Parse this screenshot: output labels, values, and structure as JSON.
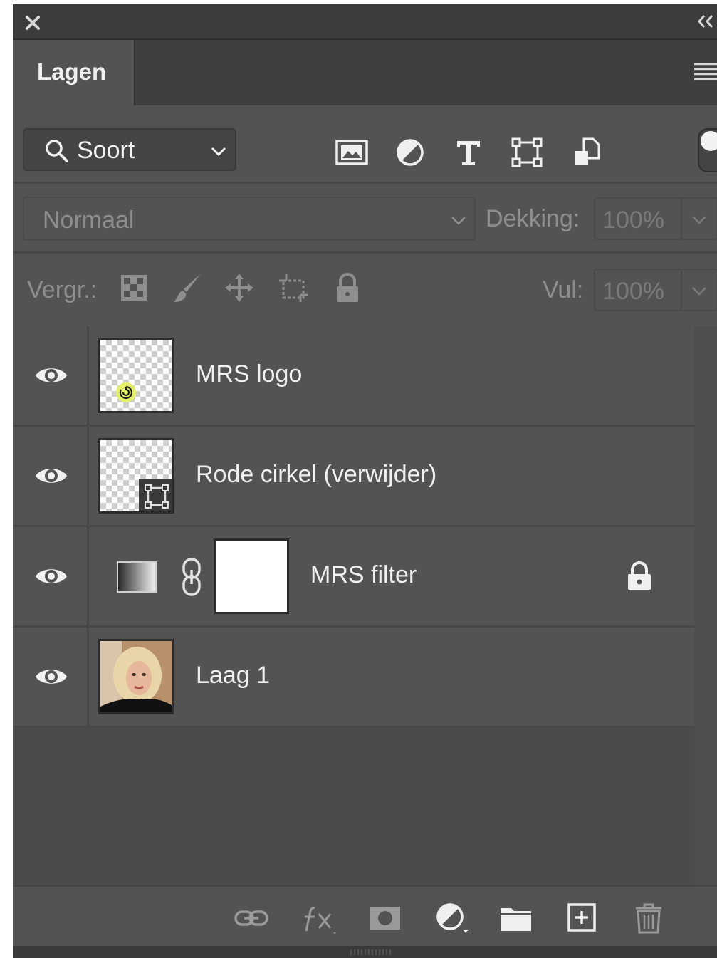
{
  "panel": {
    "tab_label": "Lagen"
  },
  "filter": {
    "kind_label": "Soort",
    "icons": [
      "pixel-layer-filter-icon",
      "adjustment-layer-filter-icon",
      "type-layer-filter-icon",
      "shape-layer-filter-icon",
      "smart-object-filter-icon"
    ]
  },
  "blend": {
    "mode": "Normaal",
    "opacity_label": "Dekking:",
    "opacity_value": "100%"
  },
  "lock": {
    "label": "Vergr.:",
    "fill_label": "Vul:",
    "fill_value": "100%"
  },
  "layers": [
    {
      "name": "MRS logo",
      "visible": true
    },
    {
      "name": "Rode cirkel (verwijder)",
      "visible": true
    },
    {
      "name": "MRS filter",
      "visible": true,
      "locked": true
    },
    {
      "name": "Laag 1",
      "visible": true
    }
  ],
  "colors": {
    "panel_bg": "#535353",
    "header_bg": "#3c3c3c",
    "text": "#f0f0f0",
    "dim_text": "#8e8e8e",
    "logo_accent": "#e4f06a"
  }
}
